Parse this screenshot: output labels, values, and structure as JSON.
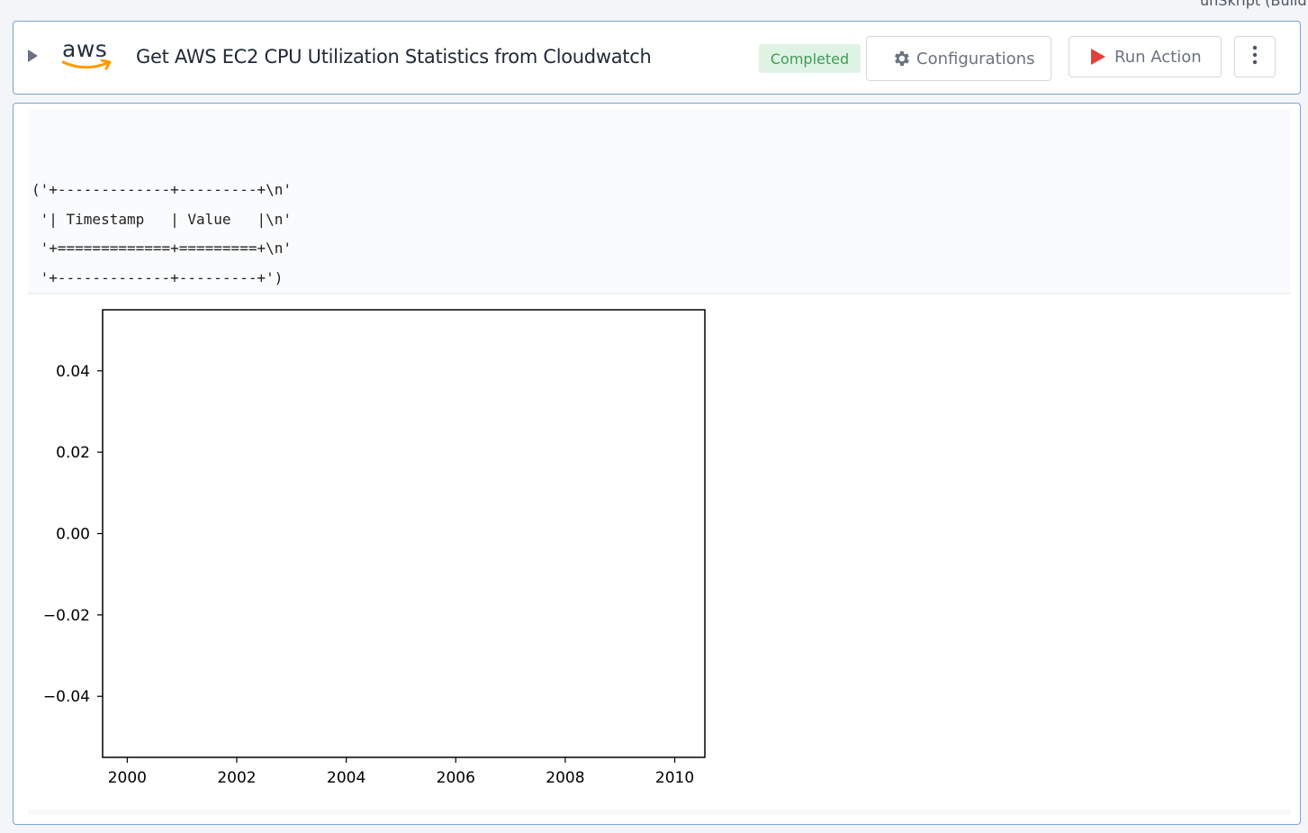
{
  "app": {
    "corner_text": "unSkript (Build"
  },
  "header": {
    "logo_text": "aws",
    "title": "Get AWS EC2 CPU Utilization Statistics from Cloudwatch",
    "status": "Completed",
    "configurations_label": "Configurations",
    "run_action_label": "Run Action"
  },
  "output": {
    "text": "('+-------------+---------+\\n'\n '| Timestamp   | Value   |\\n'\n '+=============+=========+\\n'\n '+-------------+---------+')"
  },
  "chart_data": {
    "type": "line",
    "title": "",
    "xlabel": "",
    "ylabel": "",
    "series": [],
    "xlim": [
      1999.55,
      2010.55
    ],
    "ylim": [
      -0.055,
      0.055
    ],
    "xticks": [
      2000,
      2002,
      2004,
      2006,
      2008,
      2010
    ],
    "xtick_labels": [
      "2000",
      "2002",
      "2004",
      "2006",
      "2008",
      "2010"
    ],
    "yticks": [
      0.04,
      0.02,
      0.0,
      -0.02,
      -0.04
    ],
    "ytick_labels": [
      "0.04",
      "0.02",
      "0.00",
      "−0.02",
      "−0.04"
    ],
    "grid": false
  },
  "colors": {
    "accent_border": "#7aa3d6",
    "status_bg": "#dff3e4",
    "status_text": "#3f9b53",
    "run_icon": "#e0413a",
    "aws_smile": "#ff9900"
  },
  "icons": {
    "expand": "caret-right-icon",
    "config": "gear-icon",
    "run": "play-icon",
    "more": "vertical-dots-icon"
  }
}
